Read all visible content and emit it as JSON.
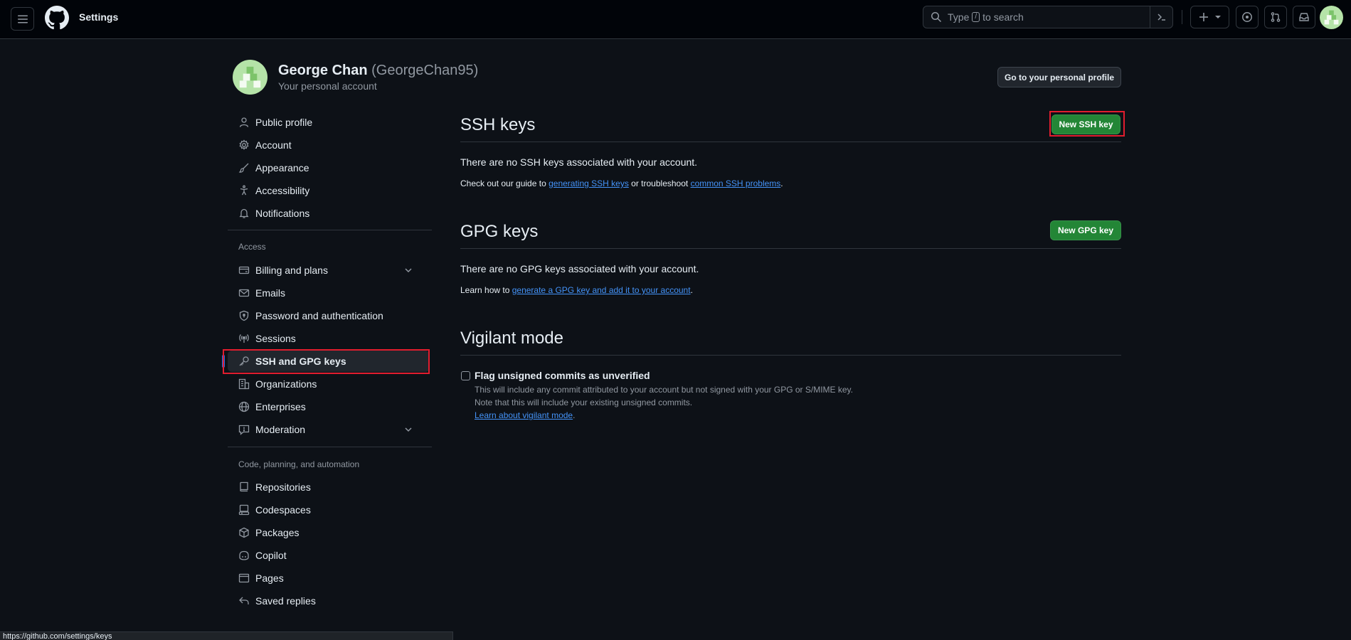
{
  "header": {
    "title": "Settings",
    "search_prefix": "Type",
    "search_key": "/",
    "search_suffix": "to search"
  },
  "profile": {
    "name": "George Chan",
    "login": "(GeorgeChan95)",
    "subtitle": "Your personal account",
    "personal_profile_button": "Go to your personal profile"
  },
  "sidebar": {
    "items": [
      {
        "label": "Public profile",
        "icon": "person-icon"
      },
      {
        "label": "Account",
        "icon": "gear-icon"
      },
      {
        "label": "Appearance",
        "icon": "paintbrush-icon"
      },
      {
        "label": "Accessibility",
        "icon": "accessibility-icon"
      },
      {
        "label": "Notifications",
        "icon": "bell-icon"
      }
    ],
    "access_group": "Access",
    "access_items": [
      {
        "label": "Billing and plans",
        "icon": "credit-card-icon"
      },
      {
        "label": "Emails",
        "icon": "mail-icon"
      },
      {
        "label": "Password and authentication",
        "icon": "shield-lock-icon"
      },
      {
        "label": "Sessions",
        "icon": "broadcast-icon"
      },
      {
        "label": "SSH and GPG keys",
        "icon": "key-icon"
      },
      {
        "label": "Organizations",
        "icon": "organization-icon"
      },
      {
        "label": "Enterprises",
        "icon": "globe-icon"
      },
      {
        "label": "Moderation",
        "icon": "report-icon"
      }
    ],
    "code_group": "Code, planning, and automation",
    "code_items": [
      {
        "label": "Repositories",
        "icon": "repo-icon"
      },
      {
        "label": "Codespaces",
        "icon": "codespaces-icon"
      },
      {
        "label": "Packages",
        "icon": "package-icon"
      },
      {
        "label": "Copilot",
        "icon": "copilot-icon"
      },
      {
        "label": "Pages",
        "icon": "browser-icon"
      },
      {
        "label": "Saved replies",
        "icon": "reply-icon"
      }
    ]
  },
  "ssh": {
    "title": "SSH keys",
    "new_button": "New SSH key",
    "empty_text": "There are no SSH keys associated with your account.",
    "guide_prefix": "Check out our guide to",
    "guide_link": "generating SSH keys",
    "guide_middle": "or troubleshoot",
    "guide_link2": "common SSH problems",
    "guide_suffix": "."
  },
  "gpg": {
    "title": "GPG keys",
    "new_button": "New GPG key",
    "empty_text": "There are no GPG keys associated with your account.",
    "learn_prefix": "Learn how to",
    "learn_link": "generate a GPG key and add it to your account",
    "learn_suffix": "."
  },
  "vigilant": {
    "title": "Vigilant mode",
    "checkbox_label": "Flag unsigned commits as unverified",
    "note1": "This will include any commit attributed to your account but not signed with your GPG or S/MIME key.",
    "note2": "Note that this will include your existing unsigned commits.",
    "note_link": "Learn about vigilant mode",
    "note_link_suffix": "."
  },
  "status_bar": {
    "url": "https://github.com/settings/keys"
  },
  "colors": {
    "accent": "#1f6feb",
    "green": "#238636",
    "link": "#4493f8",
    "highlight": "#e11d2e"
  }
}
